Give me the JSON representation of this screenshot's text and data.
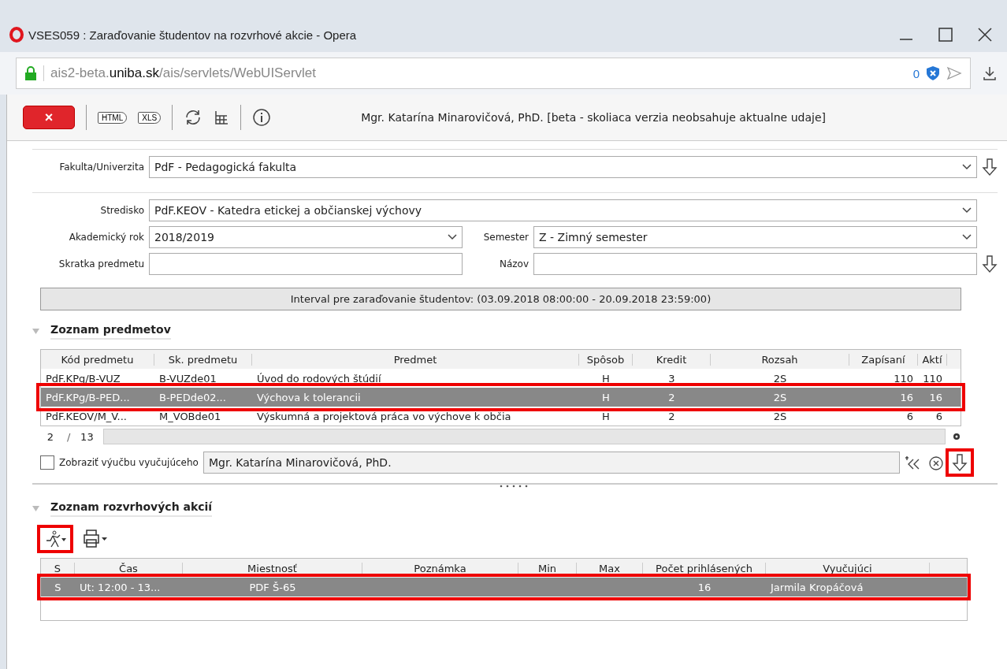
{
  "window": {
    "title": "VSES059 : Zaraďovanie študentov na rozvrhové akcie - Opera"
  },
  "address": {
    "prefix": "ais2-beta.",
    "domain": "uniba.sk",
    "path": "/ais/servlets/WebUIServlet",
    "badge": "0"
  },
  "toolbar": {
    "buttons": [
      {
        "kind": "close",
        "label": "×"
      },
      {
        "kind": "export",
        "label": "HTML"
      },
      {
        "kind": "export",
        "label": "XLS"
      }
    ],
    "user": "Mgr. Katarína Minarovičová, PhD. [beta - skoliaca verzia neobsahuje aktualne udaje]"
  },
  "faculty": {
    "label": "Fakulta/Univerzita",
    "value": "PdF - Pedagogická fakulta"
  },
  "filters": {
    "stredisko": {
      "label": "Stredisko",
      "value": "PdF.KEOV - Katedra etickej a občianskej výchovy"
    },
    "rok": {
      "label": "Akademický rok",
      "value": "2018/2019"
    },
    "semester": {
      "label": "Semester",
      "value": "Z - Zimný semester"
    },
    "skratka": {
      "label": "Skratka predmetu"
    },
    "nazov": {
      "label": "Názov"
    }
  },
  "interval": "Interval pre zaraďovanie študentov: (03.09.2018 08:00:00 - 20.09.2018 23:59:00)",
  "subjects": {
    "title": "Zoznam predmetov",
    "columns": [
      "Kód predmetu",
      "Sk. predmetu",
      "Predmet",
      "Spôsob",
      "Kredit",
      "Rozsah",
      "Zapísaní",
      "Aktí"
    ],
    "rows": [
      {
        "selected": false,
        "highlighted": false,
        "cells": [
          "PdF.KPg/B-VUZ",
          "B-VUZde01",
          "Úvod do rodových štúdií",
          "H",
          "3",
          "2S",
          "110",
          "110"
        ]
      },
      {
        "selected": true,
        "highlighted": true,
        "cells": [
          "PdF.KPg/B-PED...",
          "B-PEDde02...",
          "Výchova k tolerancii",
          "H",
          "2",
          "2S",
          "16",
          "16"
        ]
      },
      {
        "selected": false,
        "highlighted": false,
        "cells": [
          "PdF.KEOV/M_V...",
          "M_VOBde01",
          "Výskumná a projektová práca vo výchove k občia",
          "H",
          "2",
          "2S",
          "6",
          "6"
        ]
      }
    ],
    "page": "2",
    "page_separator": "/",
    "pages": "13",
    "checkbox": {
      "label": "Zobraziť výučbu vyučujúceho",
      "checked": false
    },
    "teacher": "Mgr. Katarína Minarovičová, PhD.",
    "down_highlighted": true
  },
  "actions": {
    "title": "Zoznam rozvrhových akcií",
    "run_highlighted": true,
    "columns": [
      "S",
      "Čas",
      "Miestnosť",
      "Poznámka",
      "Min",
      "Max",
      "Počet prihlásených",
      "Vyučujúci",
      ""
    ],
    "rows": [
      {
        "selected": true,
        "cells": [
          "S",
          "Ut: 12:00 - 13...",
          "PDF Š-65",
          "",
          "",
          "",
          "16",
          "Jarmila Kropáčová",
          ""
        ]
      }
    ],
    "highlighted": true
  }
}
